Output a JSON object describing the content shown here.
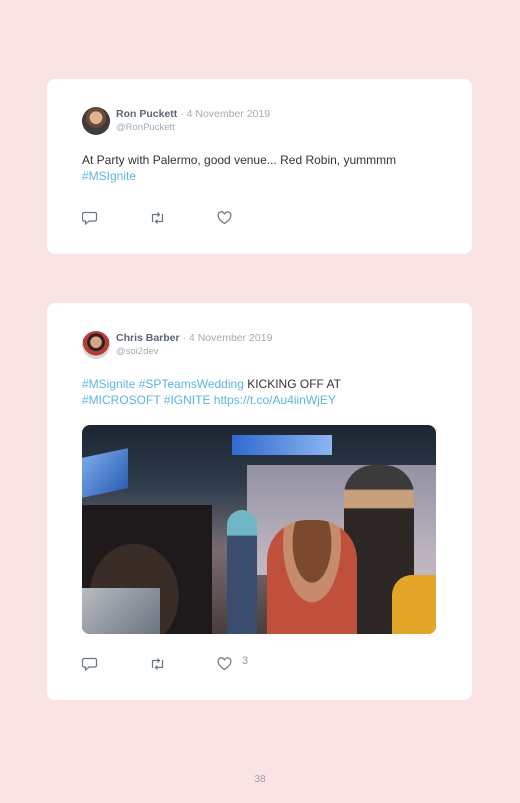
{
  "tweets": [
    {
      "author": "Ron Puckett",
      "date": "· 4 November 2019",
      "handle": "@RonPuckett",
      "text_plain": "At Party with Palermo, good venue... Red Robin, yummmm",
      "hashtag": "#MSIgnite",
      "actions": {
        "reply_icon": "reply-icon",
        "retweet_icon": "retweet-icon",
        "like_icon": "heart-icon"
      }
    },
    {
      "author": "Chris Barber",
      "date": "· 4 November 2019",
      "handle": "@soi2dev",
      "links_line1": "#MSignite #SPTeamsWedding",
      "text_line1": " KICKING OFF AT",
      "links_line2": "#MICROSOFT #IGNITE https://t.co/Au4iinWjEY",
      "actions": {
        "reply_icon": "reply-icon",
        "retweet_icon": "retweet-icon",
        "like_icon": "heart-icon",
        "like_count": "3"
      }
    }
  ],
  "page_number": "38",
  "colors": {
    "background": "#f9e3e3",
    "link": "#5bb4e6",
    "name": "#5a6675",
    "meta": "#a3abb5"
  }
}
